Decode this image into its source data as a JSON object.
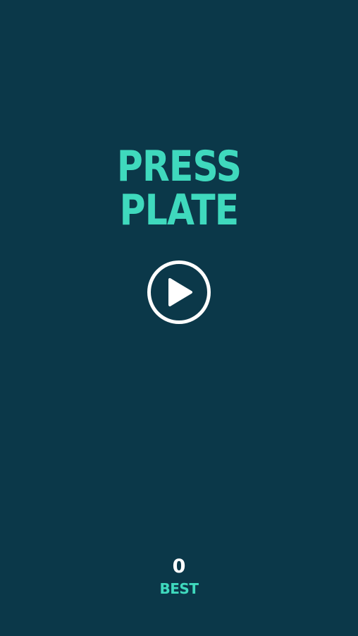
{
  "game": {
    "title_line1": "PRESS",
    "title_line2": "PLATE"
  },
  "controls": {
    "play_icon": "play-icon"
  },
  "score": {
    "best_value": "0",
    "best_label": "BEST"
  },
  "colors": {
    "background": "#0b3849",
    "accent": "#3fd9bd",
    "foreground": "#ffffff"
  }
}
